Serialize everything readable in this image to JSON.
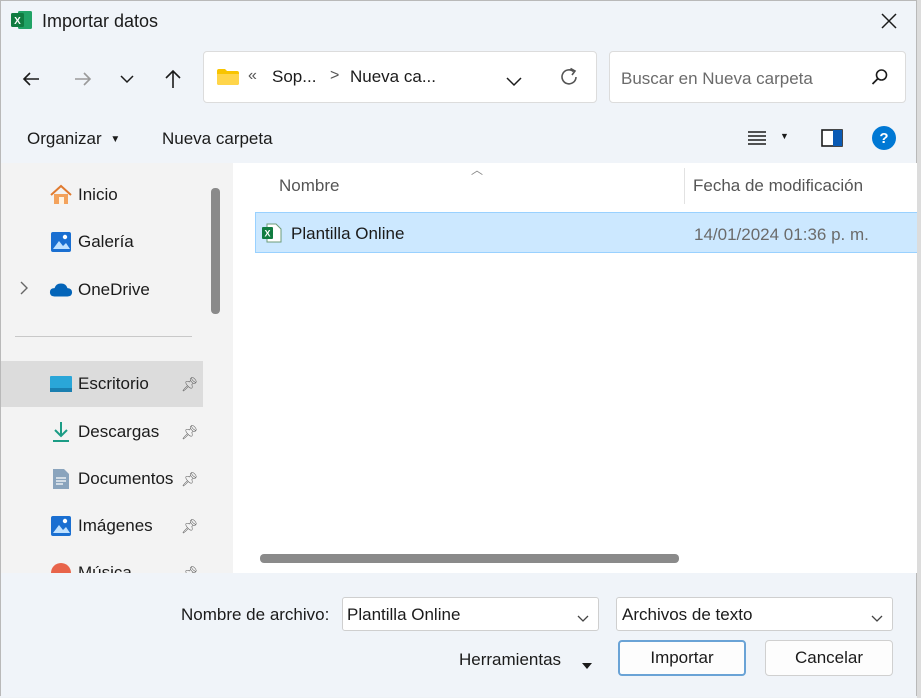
{
  "window": {
    "title": "Importar datos",
    "app_icon": "excel-icon",
    "close_icon": "close-icon"
  },
  "nav": {
    "back_icon": "back-arrow-icon",
    "forward_icon": "forward-arrow-icon",
    "recent_icon": "chevron-down-icon",
    "up_icon": "up-arrow-icon",
    "breadcrumb": {
      "overflow": "«",
      "items": [
        "Sop...",
        "Nueva ca..."
      ],
      "separator": ">"
    },
    "refresh_icon": "refresh-icon",
    "search_placeholder": "Buscar en Nueva carpeta"
  },
  "commandbar": {
    "organize": "Organizar",
    "new_folder": "Nueva carpeta",
    "view_icon": "list-view-icon",
    "preview_icon": "preview-pane-icon",
    "help_icon": "help-icon",
    "help_symbol": "?"
  },
  "sidebar": {
    "items": [
      {
        "label": "Inicio",
        "icon": "home-icon"
      },
      {
        "label": "Galería",
        "icon": "gallery-icon"
      },
      {
        "label": "OneDrive",
        "icon": "cloud-icon"
      },
      {
        "label": "Escritorio",
        "icon": "desktop-icon",
        "pinned": true
      },
      {
        "label": "Descargas",
        "icon": "download-icon",
        "pinned": true
      },
      {
        "label": "Documentos",
        "icon": "document-icon",
        "pinned": true
      },
      {
        "label": "Imágenes",
        "icon": "pictures-icon",
        "pinned": true
      },
      {
        "label": "Música",
        "icon": "music-icon",
        "pinned": true
      }
    ]
  },
  "files": {
    "columns": [
      "Nombre",
      "Fecha de modificación"
    ],
    "rows": [
      {
        "name": "Plantilla Online",
        "modified": "14/01/2024 01:36 p. m.",
        "icon": "excel-file-icon"
      }
    ]
  },
  "footer": {
    "filename_label": "Nombre de archivo:",
    "filename_value": "Plantilla Online",
    "filetype_value": "Archivos de texto",
    "tools": "Herramientas",
    "import": "Importar",
    "cancel": "Cancelar"
  },
  "colors": {
    "accent": "#0078d4",
    "selection": "#cce8ff",
    "excel_green": "#1e7145"
  }
}
